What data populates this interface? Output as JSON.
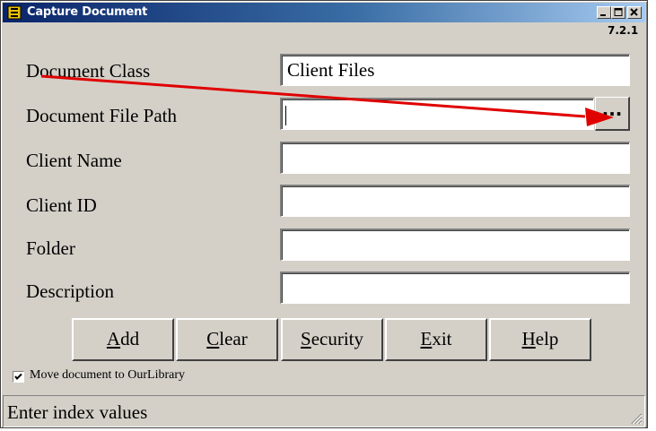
{
  "window": {
    "title": "Capture Document",
    "version": "7.2.1"
  },
  "form": {
    "fields": [
      {
        "label": "Document Class",
        "value": "Client Files"
      },
      {
        "label": "Document File Path",
        "value": ""
      },
      {
        "label": "Client Name",
        "value": ""
      },
      {
        "label": "Client ID",
        "value": ""
      },
      {
        "label": "Folder",
        "value": ""
      },
      {
        "label": "Description",
        "value": ""
      }
    ],
    "browse_label": "..."
  },
  "buttons": {
    "add": {
      "mnemonic": "A",
      "rest": "dd"
    },
    "clear": {
      "mnemonic": "C",
      "rest": "lear"
    },
    "security": {
      "mnemonic": "S",
      "rest": "ecurity"
    },
    "exit": {
      "mnemonic": "E",
      "rest": "xit"
    },
    "help": {
      "mnemonic": "H",
      "rest": "elp"
    }
  },
  "options": {
    "move_document_label": "Move document to OurLibrary",
    "move_document_checked": true
  },
  "status": {
    "text": "Enter index values"
  },
  "colors": {
    "titlebar_start": "#0a246a",
    "titlebar_end": "#a6caf0",
    "face": "#d4d0c8",
    "annotation_arrow": "#e00000"
  },
  "icons": [
    "app-icon",
    "minimize-icon",
    "maximize-icon",
    "close-icon",
    "checkmark-icon",
    "resize-grip-icon",
    "annotation-arrow"
  ]
}
